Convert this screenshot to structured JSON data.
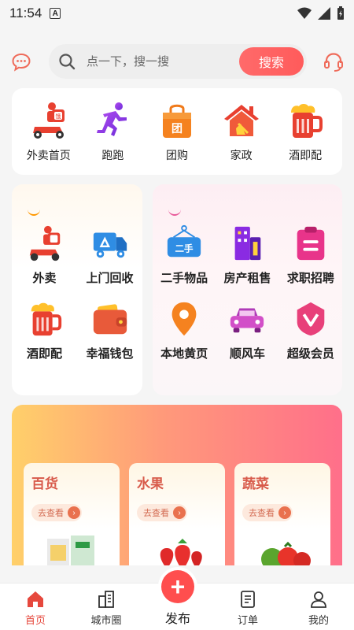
{
  "status_bar": {
    "time": "11:54",
    "badge": "A"
  },
  "search": {
    "placeholder": "点一下，搜一搜",
    "button": "搜索"
  },
  "top_nav": [
    {
      "label": "外卖首页",
      "icon": "delivery-scooter-icon"
    },
    {
      "label": "跑跑",
      "icon": "runner-icon"
    },
    {
      "label": "团购",
      "icon": "group-buy-bag-icon"
    },
    {
      "label": "家政",
      "icon": "house-broom-icon"
    },
    {
      "label": "酒即配",
      "icon": "beer-mug-icon"
    }
  ],
  "left_panel": [
    {
      "label": "外卖",
      "icon": "delivery-scooter-icon"
    },
    {
      "label": "上门回收",
      "icon": "recycle-truck-icon"
    },
    {
      "label": "酒即配",
      "icon": "beer-mug-icon"
    },
    {
      "label": "幸福钱包",
      "icon": "wallet-icon"
    }
  ],
  "right_panel": [
    {
      "label": "二手物品",
      "icon": "secondhand-tag-icon"
    },
    {
      "label": "房产租售",
      "icon": "building-icon"
    },
    {
      "label": "求职招聘",
      "icon": "clipboard-icon"
    },
    {
      "label": "本地黄页",
      "icon": "location-pin-icon"
    },
    {
      "label": "顺风车",
      "icon": "car-icon"
    },
    {
      "label": "超级会员",
      "icon": "vip-badge-icon"
    }
  ],
  "promo": {
    "cards": [
      {
        "title": "百货",
        "button": "去查看"
      },
      {
        "title": "水果",
        "button": "去查看"
      },
      {
        "title": "蔬菜",
        "button": "去查看"
      }
    ]
  },
  "tabbar": [
    {
      "label": "首页",
      "active": true
    },
    {
      "label": "城市圈",
      "active": false
    },
    {
      "label": "发布",
      "active": false
    },
    {
      "label": "订单",
      "active": false
    },
    {
      "label": "我的",
      "active": false
    }
  ],
  "colors": {
    "accent": "#ff5b5b",
    "tab_active": "#e6483d"
  }
}
